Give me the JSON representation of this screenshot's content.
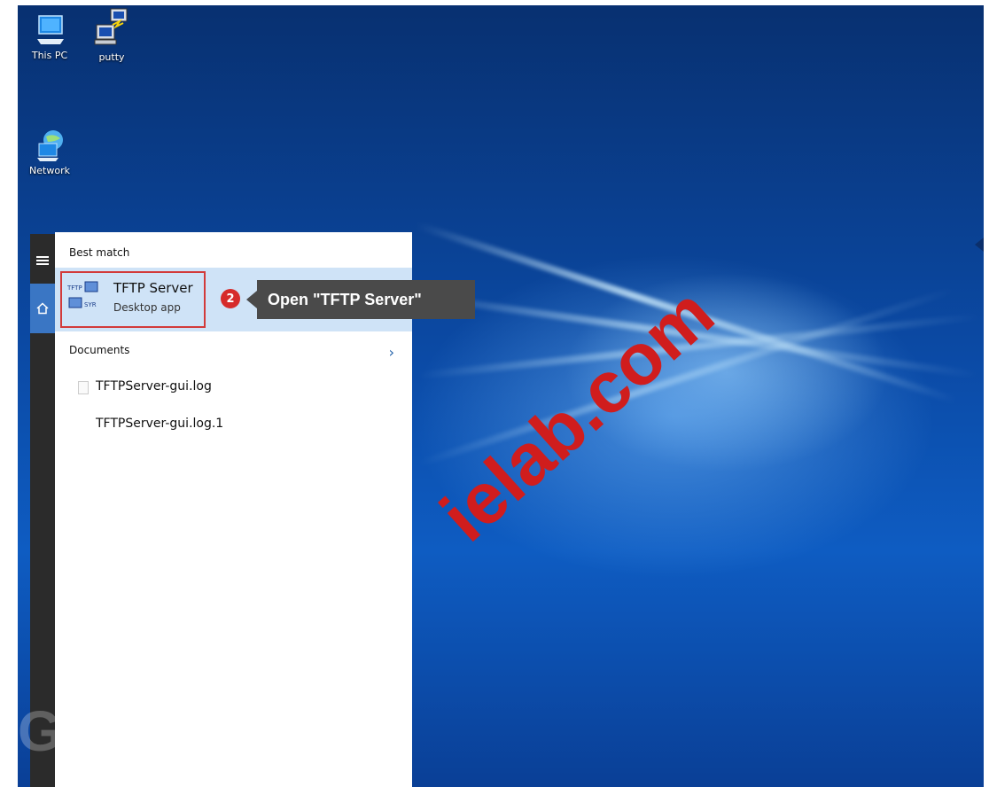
{
  "desktop": {
    "icons": [
      {
        "label": "This PC",
        "icon": "computer-icon"
      },
      {
        "label": "putty",
        "icon": "putty-icon"
      },
      {
        "label": "Network",
        "icon": "network-icon"
      }
    ]
  },
  "start_menu": {
    "rail": {
      "menu_icon": "hamburger-icon",
      "home_icon": "home-icon"
    }
  },
  "search_results": {
    "best_match_title": "Best match",
    "best_match": {
      "name": "TFTP Server",
      "subtitle": "Desktop app",
      "icon": "tftp-server-icon"
    },
    "documents_title": "Documents",
    "documents": [
      "TFTPServer-gui.log",
      "TFTPServer-gui.log.1"
    ]
  },
  "callout": {
    "step": "2",
    "text": "Open \"TFTP Server\""
  },
  "watermark": "ielab.com",
  "colors": {
    "highlight_border": "#d23a3a",
    "step_badge": "#d62b2b",
    "callout_bg": "#4a4a4a",
    "selected_row": "#cfe3f7",
    "watermark": "#d01d1d"
  }
}
